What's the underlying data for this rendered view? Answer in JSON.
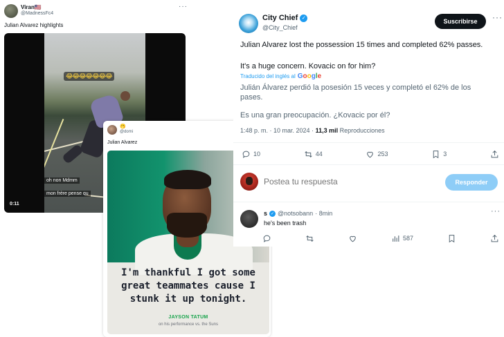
{
  "left_tweet": {
    "name": "Viran🇺🇸",
    "handle": "@MadnessFc4",
    "more": "···",
    "text": "Julian Alvarez highlights",
    "video": {
      "emoji_overlay": "😂😂😂😂😂😂😂",
      "caption_1": "oh non Mdmm",
      "caption_2": "mon frère pense qu",
      "caption_3": "",
      "time": "0:11"
    }
  },
  "middle_tweet": {
    "name": "🫢",
    "handle": "@domi",
    "text": "Julian Alvarez",
    "quote": "I'm thankful I got some great teammates cause I stunk it up tonight.",
    "author": "JAYSON TATUM",
    "sub": "on his performance vs. the Suns"
  },
  "right_tweet": {
    "name": "City Chief",
    "handle": "@City_Chief",
    "subscribe_label": "Suscribirse",
    "more": "···",
    "text_1": "Julian Alvarez lost the possession 15 times and completed 62% passes.",
    "text_2": "It's a huge concern. Kovacic on for him?",
    "translated_label": "Traducido del inglés al",
    "google": "Google",
    "es_1": "Julián Álvarez perdió la posesión 15 veces y completó el 62% de los pases.",
    "es_2": "Es una gran preocupación. ¿Kovacic por él?",
    "meta_time": "1:48 p. m. · 10 mar. 2024 · ",
    "meta_views": "11,3 mil",
    "meta_views_label": " Reproducciones",
    "actions": {
      "replies": "10",
      "retweets": "44",
      "likes": "253",
      "bookmarks": "3"
    },
    "reply_placeholder": "Postea tu respuesta",
    "reply_button": "Responder",
    "comment": {
      "name": "s",
      "handle": "@notsobann",
      "time": "· 8min",
      "text": "he's been trash",
      "views": "587",
      "more": "···"
    }
  },
  "colors": {
    "accent": "#1d9bf0",
    "text": "#0f1419",
    "secondary": "#536471",
    "subscribe_bg": "#0f1419",
    "reply_btn_bg": "#8ecdf7"
  }
}
